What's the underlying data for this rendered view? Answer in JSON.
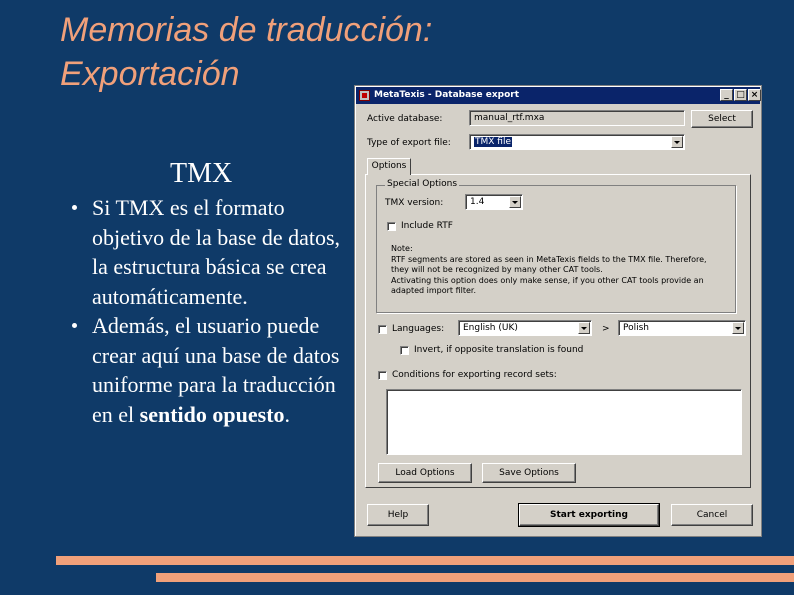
{
  "slide": {
    "title_line1": "Memorias de traducción:",
    "title_line2": "Exportación",
    "subtitle": "TMX",
    "bullet1": "Si TMX es el formato objetivo de la base de datos, la estructura básica se crea automáticamente.",
    "bullet2_main": "Además, el usuario puede crear aquí una base de datos uniforme para la traducción en el ",
    "bullet2_bold": "sentido opuesto",
    "bullet2_end": "."
  },
  "dialog": {
    "title": "MetaTexis - Database export",
    "active_db_label": "Active database:",
    "active_db_value": "manual_rtf.mxa",
    "select_button": "Select",
    "export_type_label": "Type of export file:",
    "export_type_value": "TMX file",
    "tab_options": "Options",
    "special_options": "Special Options",
    "tmx_version_label": "TMX version:",
    "tmx_version_value": "1.4",
    "include_rtf": "Include RTF",
    "note_lines": [
      "Note:",
      "RTF segments are stored as seen in MetaTexis fields to the TMX file. Therefore,",
      "they will not be recognized by many other CAT tools.",
      "Activating this option does only make sense, if you other CAT tools provide an",
      "adapted import filter."
    ],
    "languages_label": "Languages:",
    "lang_from": "English (UK)",
    "lang_arrow": ">",
    "lang_to": "Polish",
    "invert": "Invert, if opposite translation is found",
    "conditions": "Conditions for exporting record sets:",
    "load_options": "Load Options",
    "save_options": "Save Options",
    "help": "Help",
    "start_exporting": "Start exporting",
    "cancel": "Cancel",
    "win_minimize": "_",
    "win_maximize": "□",
    "win_close": "×"
  }
}
